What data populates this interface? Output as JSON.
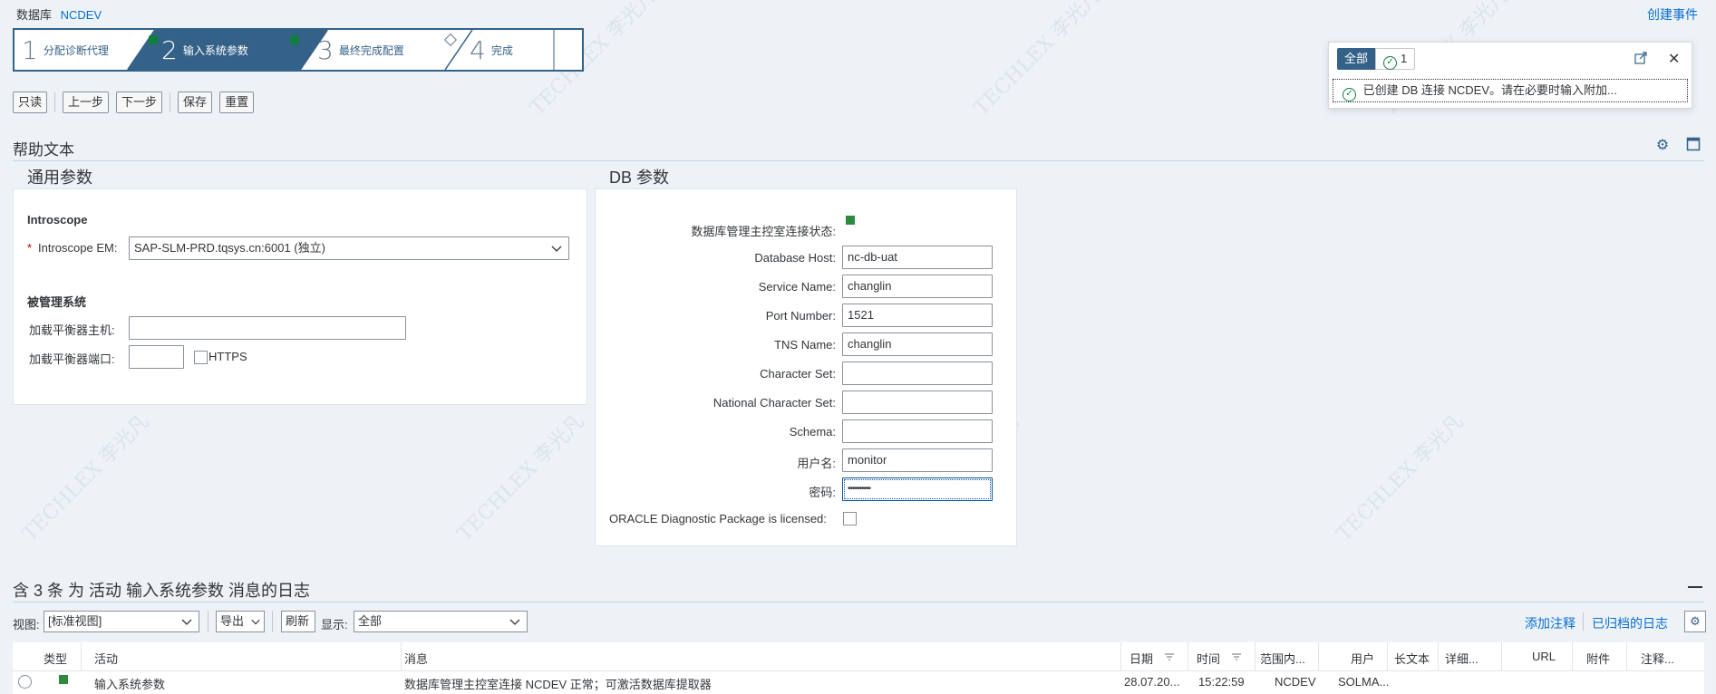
{
  "header": {
    "label": "数据库",
    "system": "NCDEV",
    "create_event": "创建事件"
  },
  "roadmap": {
    "steps": [
      {
        "num": "1",
        "label": "分配诊断代理",
        "status": "done"
      },
      {
        "num": "2",
        "label": "输入系统参数",
        "status": "active"
      },
      {
        "num": "3",
        "label": "最终完成配置",
        "status": "pending"
      },
      {
        "num": "4",
        "label": "完成",
        "status": "none"
      }
    ]
  },
  "toolbar": {
    "readonly": "只读",
    "back": "上一步",
    "next": "下一步",
    "save": "保存",
    "reset": "重置"
  },
  "help": {
    "title": "帮助文本",
    "settings_icon": "gear-icon",
    "maximize_icon": "maximize-icon"
  },
  "general": {
    "title": "通用参数",
    "introscope_heading": "Introscope",
    "em_label": "Introscope EM:",
    "em_value": "SAP-SLM-PRD.tqsys.cn:6001 (独立)",
    "managed_heading": "被管理系统",
    "lb_host_label": "加载平衡器主机:",
    "lb_host_value": "",
    "lb_port_label": "加载平衡器端口:",
    "lb_port_value": "",
    "https_label": "HTTPS"
  },
  "db": {
    "title": "DB 参数",
    "status_label": "数据库管理主控室连接状态:",
    "status_color": "#2e8b3e",
    "host_label": "Database Host:",
    "host_value": "nc-db-uat",
    "service_label": "Service Name:",
    "service_value": "changlin",
    "port_label": "Port Number:",
    "port_value": "1521",
    "tns_label": "TNS Name:",
    "tns_value": "changlin",
    "charset_label": "Character Set:",
    "charset_value": "",
    "ncharset_label": "National Character Set:",
    "ncharset_value": "",
    "schema_label": "Schema:",
    "schema_value": "",
    "user_label": "用户名:",
    "user_value": "monitor",
    "pwd_label": "密码:",
    "pwd_value": "••••••••••",
    "oracle_label": "ORACLE Diagnostic Package is licensed:"
  },
  "notification": {
    "all_label": "全部",
    "count": "1",
    "message": "已创建 DB 连接 NCDEV。请在必要时输入附加..."
  },
  "log": {
    "title": "含 3 条 为 活动 输入系统参数 消息的日志",
    "view_label": "视图:",
    "view_value": "[标准视图]",
    "export_label": "导出",
    "refresh_label": "刷新",
    "show_label": "显示:",
    "show_value": "全部",
    "add_note": "添加注释",
    "archived_log": "已归档的日志",
    "columns": [
      "类型",
      "活动",
      "消息",
      "日期",
      "时间",
      "范围内...",
      "用户",
      "长文本",
      "详细...",
      "URL",
      "附件",
      "注释..."
    ],
    "rows": [
      {
        "activity": "输入系统参数",
        "message": "数据库管理主控室连接 NCDEV 正常；可激活数据库提取器",
        "date": "28.07.20...",
        "time": "15:22:59",
        "scope": "NCDEV",
        "user": "SOLMA..."
      }
    ]
  }
}
